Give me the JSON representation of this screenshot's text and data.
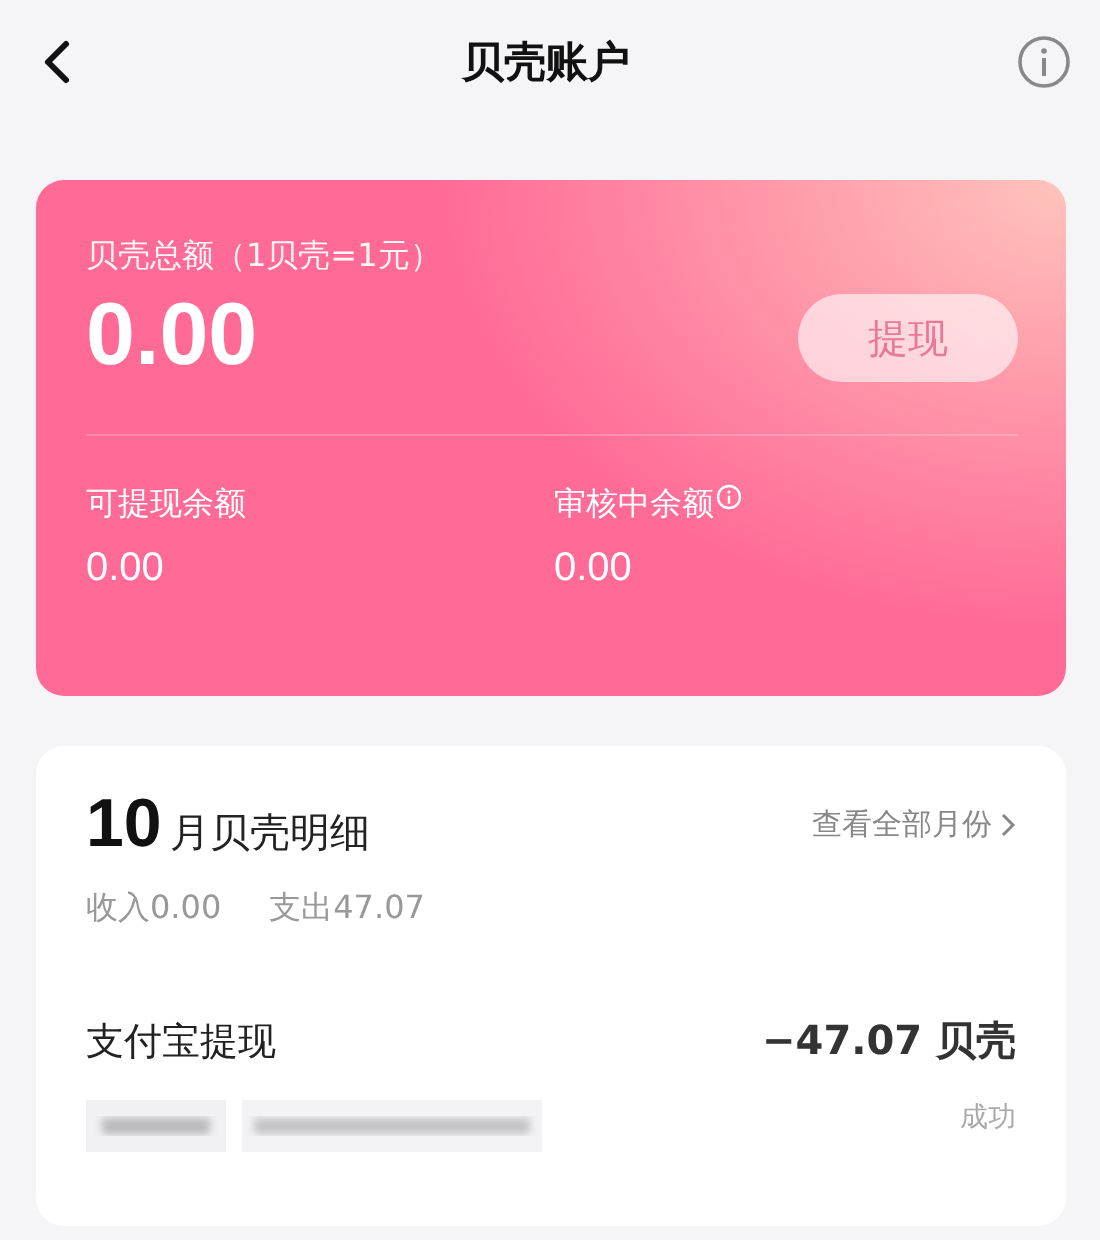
{
  "header": {
    "title": "贝壳账户"
  },
  "balance": {
    "label": "贝壳总额（1贝壳=1元）",
    "amount": "0.00",
    "button": {
      "label": "提现",
      "disabled": true
    },
    "sub": [
      {
        "label": "可提现余额",
        "value": "0.00",
        "info": false
      },
      {
        "label": "审核中余额",
        "value": "0.00",
        "info": true
      }
    ]
  },
  "detail": {
    "month": "10",
    "title": "月贝壳明细",
    "link": "查看全部月份",
    "income": "收入0.00",
    "expense": "支出47.07",
    "records": [
      {
        "name": "支付宝提现",
        "amount": "−47.07 贝壳",
        "status": "成功"
      }
    ]
  }
}
